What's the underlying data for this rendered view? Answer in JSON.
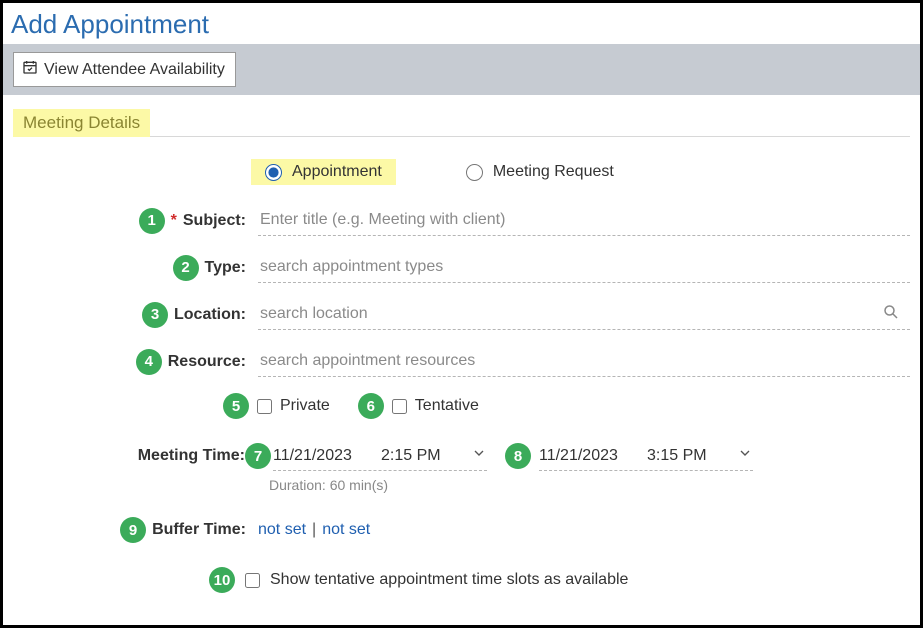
{
  "page": {
    "title": "Add Appointment"
  },
  "toolbar": {
    "view_availability_label": "View Attendee Availability"
  },
  "section": {
    "title": "Meeting Details"
  },
  "type_radio": {
    "appointment": "Appointment",
    "meeting_request": "Meeting Request",
    "selected": "appointment"
  },
  "badges": {
    "subject": "1",
    "type": "2",
    "location": "3",
    "resource": "4",
    "private": "5",
    "tentative": "6",
    "start": "7",
    "end": "8",
    "buffer": "9",
    "show_tentative": "10"
  },
  "fields": {
    "subject": {
      "label": "Subject:",
      "placeholder": "Enter title (e.g. Meeting with client)",
      "required": "*"
    },
    "type": {
      "label": "Type:",
      "placeholder": "search appointment types"
    },
    "location": {
      "label": "Location:",
      "placeholder": "search location"
    },
    "resource": {
      "label": "Resource:",
      "placeholder": "search appointment resources"
    },
    "private": {
      "label": "Private"
    },
    "tentative": {
      "label": "Tentative"
    },
    "meeting_time": {
      "label": "Meeting Time:"
    },
    "start": {
      "date": "11/21/2023",
      "time": "2:15 PM"
    },
    "end": {
      "date": "11/21/2023",
      "time": "3:15 PM"
    },
    "duration": "Duration: 60 min(s)",
    "buffer": {
      "label": "Buffer Time:",
      "before": "not set",
      "after": "not set",
      "sep": "|"
    },
    "show_tentative": {
      "label": "Show tentative appointment time slots as available"
    }
  }
}
